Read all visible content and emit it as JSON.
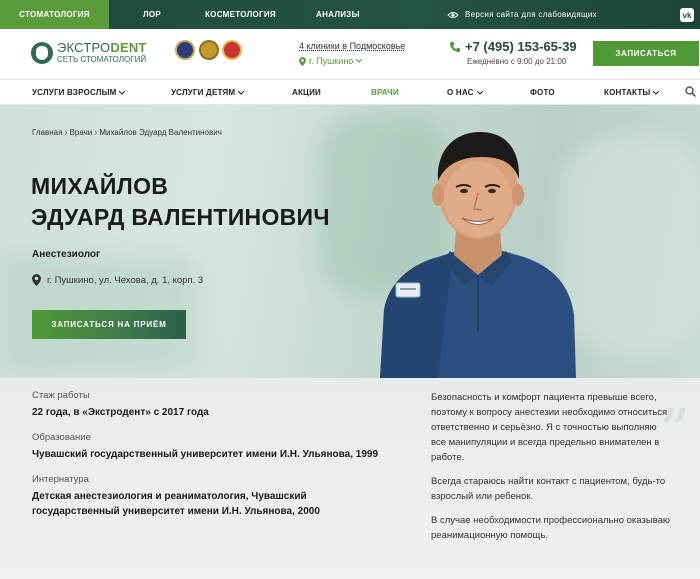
{
  "topbar": {
    "items": [
      "СТОМАТОЛОГИЯ",
      "ЛОР",
      "КОСМЕТОЛОГИЯ",
      "АНАЛИЗЫ"
    ],
    "vision": "Версия сайта для слабовидящих",
    "vision_icon": "eye-icon",
    "vk": "vk"
  },
  "header": {
    "logo_part1": "ЭКСТРО",
    "logo_part2": "DENT",
    "logo_sub": "СЕТЬ СТОМАТОЛОГИЙ",
    "clinics": "4 клиники в Подмосковье",
    "city": "г. Пушкино",
    "phone": "+7 (495) 153-65-39",
    "hours": "Ежедневно с 9:00 до 21:00",
    "cta": "ЗАПИСАТЬСЯ"
  },
  "nav": {
    "items": [
      "УСЛУГИ ВЗРОСЛЫМ",
      "УСЛУГИ ДЕТЯМ",
      "АКЦИИ",
      "ВРАЧИ",
      "О НАС",
      "ФОТО",
      "КОНТАКТЫ"
    ]
  },
  "hero": {
    "breadcrumb": "Главная › Врачи › Михайлов Эдуард Валентинович",
    "name_line1": "МИХАЙЛОВ",
    "name_line2": "ЭДУАРД ВАЛЕНТИНОВИЧ",
    "specialty": "Анестезиолог",
    "address": "г. Пушкино, ул. Чехова, д. 1, корп. 3",
    "cta": "ЗАПИСАТЬСЯ НА ПРИЁМ"
  },
  "info": {
    "experience_label": "Стаж работы",
    "experience_value": "22 года, в «Экстродент» с 2017 года",
    "education_label": "Образование",
    "education_value": "Чувашский государственный университет имени И.Н. Ульянова, 1999",
    "internship_label": "Интернатура",
    "internship_value": "Детская анестезиология и реаниматология, Чувашский государственный университет имени И.Н. Ульянова, 2000",
    "quote_p1": "Безопасность и комфорт пациента превыше всего, поэтому к вопросу анестезии необходимо относиться ответственно и серьёзно. Я с точностью выполняю все манипуляции и всегда предельно внимателен в работе.",
    "quote_p2": "Всегда стараюсь найти контакт с пациентом, будь-то взрослый или ребенок.",
    "quote_p3": "В случае необходимости профессионально оказываю реанимационную помощь."
  },
  "colors": {
    "brand_dark": "#235343",
    "brand_green": "#5a9c3a"
  }
}
